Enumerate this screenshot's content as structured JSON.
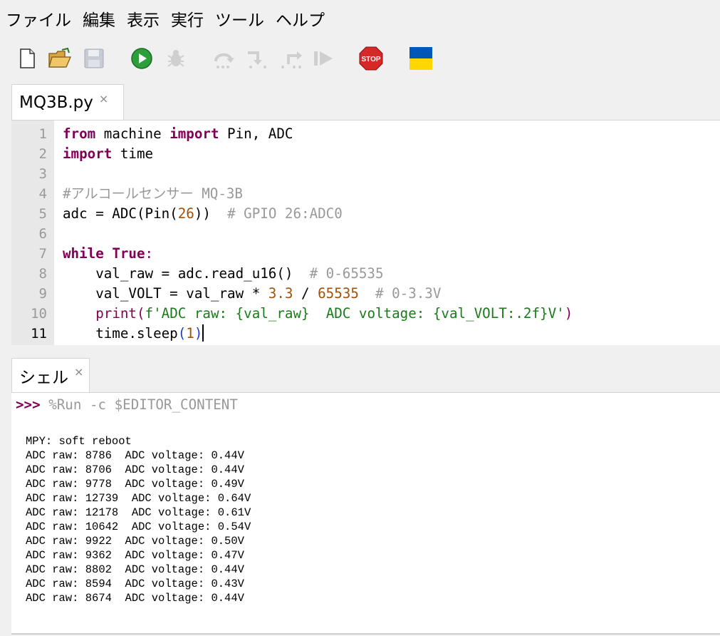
{
  "menu": [
    "ファイル",
    "編集",
    "表示",
    "実行",
    "ツール",
    "ヘルプ"
  ],
  "toolbar": {
    "icons": [
      "new-file-icon",
      "open-folder-icon",
      "save-icon",
      "run-icon",
      "debug-icon",
      "step-over-icon",
      "step-into-icon",
      "step-out-icon",
      "resume-icon",
      "stop-icon",
      "ukraine-flag-icon"
    ],
    "stop_label": "STOP",
    "colors": {
      "run": "#2e9e3a",
      "stop": "#d62828",
      "flag_blue": "#0057b7",
      "flag_yellow": "#ffd700"
    }
  },
  "editor": {
    "tab_label": "MQ3B.py",
    "tab_close": "×",
    "line_numbers": [
      "1",
      "2",
      "3",
      "4",
      "5",
      "6",
      "7",
      "8",
      "9",
      "10",
      "11"
    ],
    "active_line": "11",
    "code": {
      "l1": {
        "kw1": "from",
        "t1": " machine ",
        "kw2": "import",
        "t2": " Pin, ADC"
      },
      "l2": {
        "kw1": "import",
        "t1": " time"
      },
      "l4": {
        "cmt": "#アルコールセンサー MQ-3B"
      },
      "l5": {
        "t1": "adc = ADC(Pin(",
        "num": "26",
        "t2": "))  ",
        "cmt": "# GPIO 26:ADC0"
      },
      "l7": {
        "kw1": "while",
        "t1": " ",
        "kw2": "True",
        "pun": ":"
      },
      "l8": {
        "t1": "    val_raw = adc.read_u16()  ",
        "cmt": "# 0-65535"
      },
      "l9": {
        "t1": "    val_VOLT = val_raw * ",
        "num1": "3.3",
        "t2": " / ",
        "num2": "65535",
        "t3": "  ",
        "cmt": "# 0-3.3V"
      },
      "l10": {
        "indent": "    ",
        "fn": "print",
        "p1": "(",
        "str": "f'ADC raw: {val_raw}  ADC voltage: {val_VOLT:.2f}V'",
        "p2": ")"
      },
      "l11": {
        "t1": "    time.sleep",
        "p1": "(",
        "num": "1",
        "p2": ")"
      }
    }
  },
  "shell": {
    "tab_label": "シェル",
    "tab_close": "×",
    "prompt": ">>>",
    "command": " %Run -c $EDITOR_CONTENT",
    "output": [
      "MPY: soft reboot",
      "ADC raw: 8786  ADC voltage: 0.44V",
      "ADC raw: 8706  ADC voltage: 0.44V",
      "ADC raw: 9778  ADC voltage: 0.49V",
      "ADC raw: 12739  ADC voltage: 0.64V",
      "ADC raw: 12178  ADC voltage: 0.61V",
      "ADC raw: 10642  ADC voltage: 0.54V",
      "ADC raw: 9922  ADC voltage: 0.50V",
      "ADC raw: 9362  ADC voltage: 0.47V",
      "ADC raw: 8802  ADC voltage: 0.44V",
      "ADC raw: 8594  ADC voltage: 0.43V",
      "ADC raw: 8674  ADC voltage: 0.44V"
    ]
  }
}
